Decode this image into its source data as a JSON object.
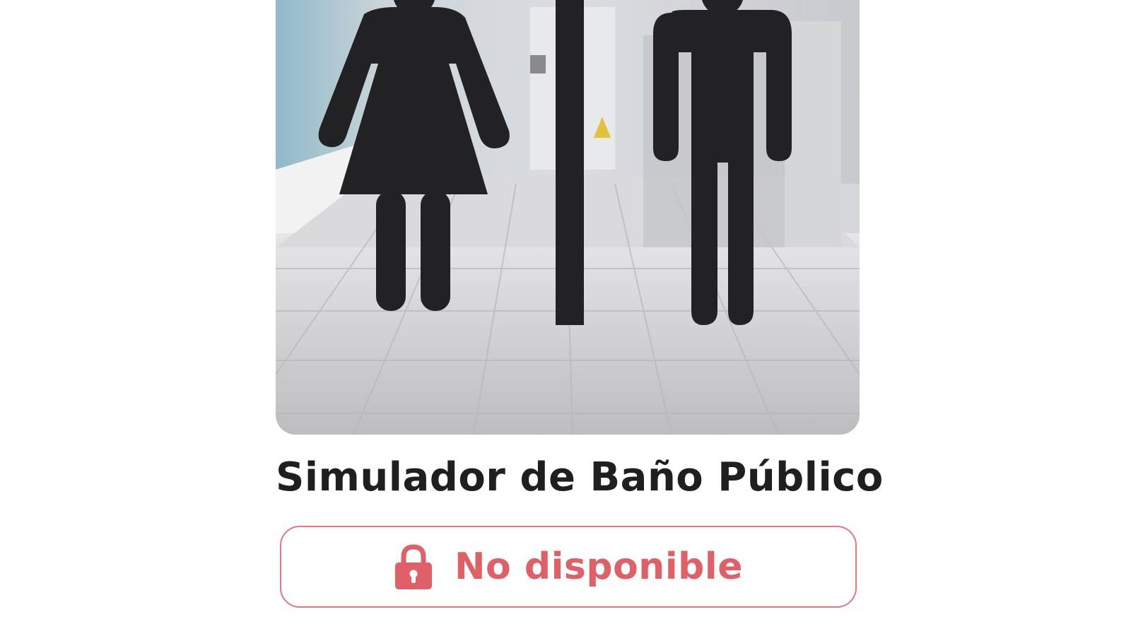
{
  "game": {
    "title": "Simulador de Baño Público",
    "thumbnail": "restroom-sign-thumbnail"
  },
  "status_button": {
    "label": "No disponible",
    "icon": "lock-icon",
    "color": "#e06068",
    "border_color": "#e07a7f"
  }
}
